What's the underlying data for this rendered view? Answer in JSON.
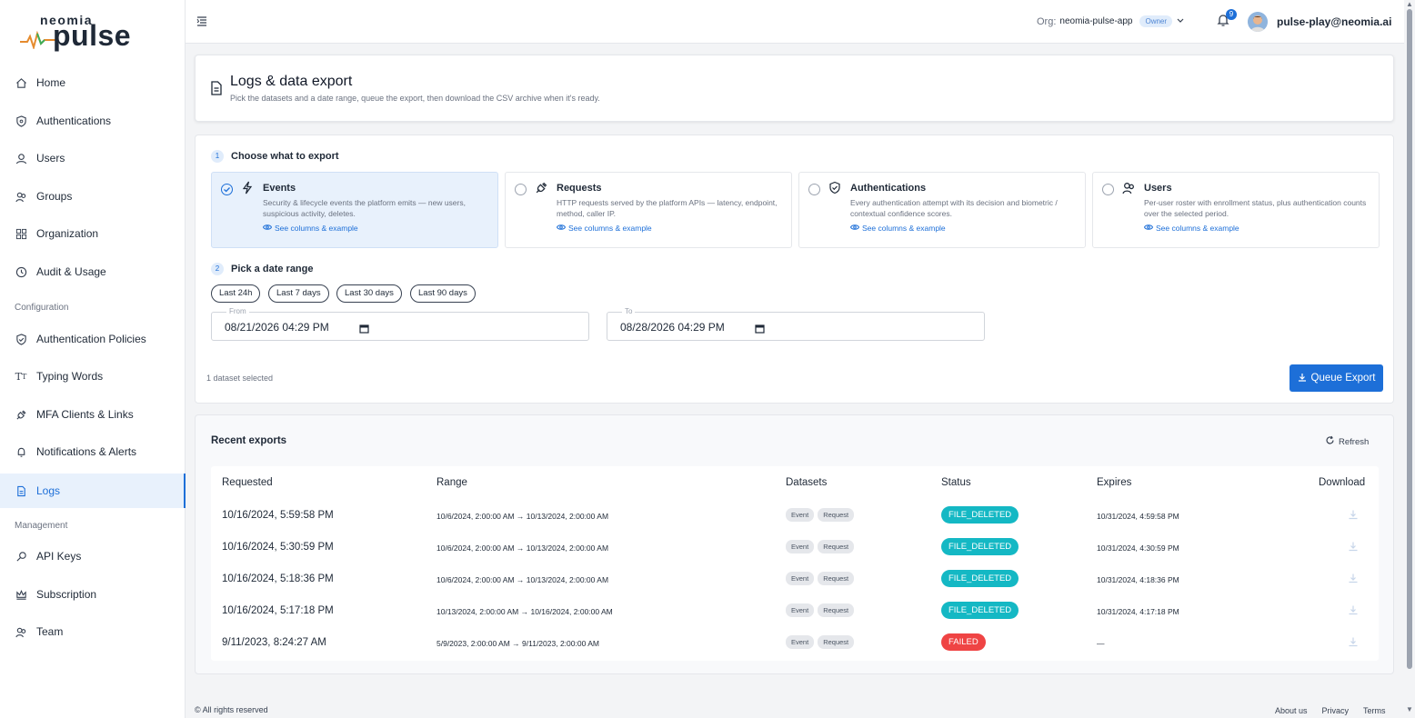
{
  "brand": {
    "top": "neomia",
    "main": "pulse",
    "accent": "#1d6fd8",
    "wave_color": "#e58b2e"
  },
  "sidebar": {
    "items": [
      {
        "label": "Home",
        "icon": "home-icon"
      },
      {
        "label": "Authentications",
        "icon": "shield-icon"
      },
      {
        "label": "Users",
        "icon": "user-icon"
      },
      {
        "label": "Groups",
        "icon": "users-icon"
      },
      {
        "label": "Organization",
        "icon": "grid-icon"
      },
      {
        "label": "Audit & Usage",
        "icon": "clock-icon"
      }
    ],
    "section_configuration": "Configuration",
    "config_items": [
      {
        "label": "Authentication Policies",
        "icon": "shield-check-icon"
      },
      {
        "label": "Typing Words",
        "icon": "text-icon"
      },
      {
        "label": "MFA Clients & Links",
        "icon": "plug-icon"
      },
      {
        "label": "Notifications & Alerts",
        "icon": "bell-icon"
      },
      {
        "label": "Logs",
        "icon": "document-icon",
        "active": true
      }
    ],
    "section_management": "Management",
    "mgmt_items": [
      {
        "label": "API Keys",
        "icon": "key-icon"
      },
      {
        "label": "Subscription",
        "icon": "crown-icon"
      },
      {
        "label": "Team",
        "icon": "team-icon"
      }
    ]
  },
  "topbar": {
    "org_label": "Org:",
    "org_name": "neomia-pulse-app",
    "org_role": "Owner",
    "notification_count": "9",
    "user_email": "pulse-play@neomia.ai"
  },
  "page": {
    "title": "Logs & data export",
    "subtitle": "Pick the datasets and a date range, queue the export, then download the CSV archive when it's ready."
  },
  "export": {
    "step1_num": "1",
    "step1_label": "Choose what to export",
    "datasets": [
      {
        "title": "Events",
        "desc": "Security & lifecycle events the platform emits — new users, suspicious activity, deletes.",
        "link": "See columns & example",
        "selected": true
      },
      {
        "title": "Requests",
        "desc": "HTTP requests served by the platform APIs — latency, endpoint, method, caller IP.",
        "link": "See columns & example",
        "selected": false
      },
      {
        "title": "Authentications",
        "desc": "Every authentication attempt with its decision and biometric / contextual confidence scores.",
        "link": "See columns & example",
        "selected": false
      },
      {
        "title": "Users",
        "desc": "Per-user roster with enrollment status, plus authentication counts over the selected period.",
        "link": "See columns & example",
        "selected": false
      }
    ],
    "step2_num": "2",
    "step2_label": "Pick a date range",
    "ranges": [
      "Last 24h",
      "Last 7 days",
      "Last 30 days",
      "Last 90 days"
    ],
    "from_label": "From",
    "from_value": "08/21/2026 04:29 PM",
    "to_label": "To",
    "to_value": "08/28/2026 04:29 PM",
    "selected_count": "1 dataset selected",
    "queue_button": "Queue Export"
  },
  "recent": {
    "title": "Recent exports",
    "refresh": "Refresh",
    "headers": [
      "Requested",
      "Range",
      "Datasets",
      "Status",
      "Expires",
      "Download"
    ],
    "rows": [
      {
        "requested": "10/16/2024, 5:59:58 PM",
        "range": "10/6/2024, 2:00:00 AM → 10/13/2024, 2:00:00 AM",
        "datasets": [
          "Event",
          "Request"
        ],
        "status": "FILE_DELETED",
        "status_color": "#14b8c4",
        "expires": "10/31/2024, 4:59:58 PM"
      },
      {
        "requested": "10/16/2024, 5:30:59 PM",
        "range": "10/6/2024, 2:00:00 AM → 10/13/2024, 2:00:00 AM",
        "datasets": [
          "Event",
          "Request"
        ],
        "status": "FILE_DELETED",
        "status_color": "#14b8c4",
        "expires": "10/31/2024, 4:30:59 PM"
      },
      {
        "requested": "10/16/2024, 5:18:36 PM",
        "range": "10/6/2024, 2:00:00 AM → 10/13/2024, 2:00:00 AM",
        "datasets": [
          "Event",
          "Request"
        ],
        "status": "FILE_DELETED",
        "status_color": "#14b8c4",
        "expires": "10/31/2024, 4:18:36 PM"
      },
      {
        "requested": "10/16/2024, 5:17:18 PM",
        "range": "10/13/2024, 2:00:00 AM → 10/16/2024, 2:00:00 AM",
        "datasets": [
          "Event",
          "Request"
        ],
        "status": "FILE_DELETED",
        "status_color": "#14b8c4",
        "expires": "10/31/2024, 4:17:18 PM"
      },
      {
        "requested": "9/11/2023, 8:24:27 AM",
        "range": "5/9/2023, 2:00:00 AM → 9/11/2023, 2:00:00 AM",
        "datasets": [
          "Event",
          "Request"
        ],
        "status": "FAILED",
        "status_color": "#ef4444",
        "expires": "—"
      }
    ]
  },
  "footer": {
    "copyright": "© All rights reserved",
    "links": [
      "About us",
      "Privacy",
      "Terms"
    ]
  }
}
